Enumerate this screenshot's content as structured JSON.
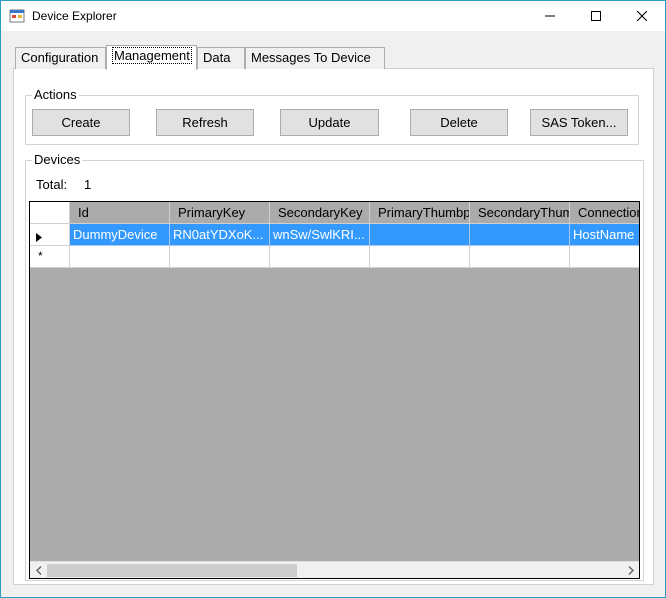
{
  "window": {
    "title": "Device Explorer",
    "icon": "app-icon",
    "controls": [
      "minimize-icon",
      "maximize-icon",
      "close-icon"
    ]
  },
  "tabs": [
    {
      "label": "Configuration",
      "active": false
    },
    {
      "label": "Management",
      "active": true
    },
    {
      "label": "Data",
      "active": false
    },
    {
      "label": "Messages To Device",
      "active": false
    }
  ],
  "actions": {
    "title": "Actions",
    "buttons": {
      "create": "Create",
      "refresh": "Refresh",
      "update": "Update",
      "delete": "Delete",
      "sas_token": "SAS Token..."
    }
  },
  "devices": {
    "title": "Devices",
    "total_label": "Total:",
    "total_value": "1",
    "columns": [
      "Id",
      "PrimaryKey",
      "SecondaryKey",
      "PrimaryThumbprint",
      "SecondaryThumbprint",
      "ConnectionString"
    ],
    "rows": [
      {
        "id": "DummyDevice",
        "primary_key": "RN0atYDXoK...",
        "secondary_key": "wnSw/SwlKRI...",
        "primary_thumbprint": "",
        "secondary_thumbprint": "",
        "connection": "HostName"
      }
    ],
    "row_markers": {
      "current": "row-pointer-icon",
      "new": "*"
    }
  },
  "colors": {
    "selection": "#3399ff",
    "grid_background": "#ababab",
    "window_border": "#2a9fc0"
  }
}
